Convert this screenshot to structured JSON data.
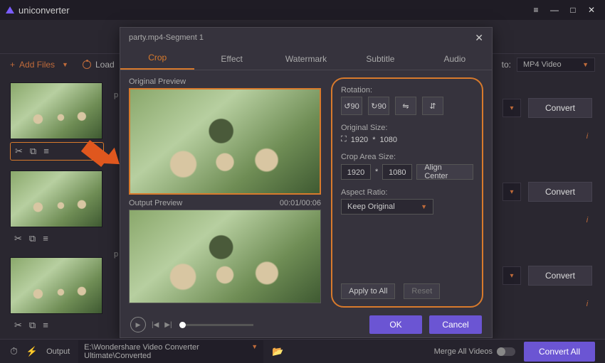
{
  "app": {
    "name": "uniconverter"
  },
  "window": {
    "menu": "≡",
    "min": "—",
    "max": "□",
    "close": "✕"
  },
  "toolbar": {
    "addfiles": "Add Files",
    "load": "Load",
    "to": "to:",
    "format": "MP4 Video"
  },
  "side": {
    "icons_cut": "✂",
    "icons_crop": "⧉",
    "icons_adjust": "≡"
  },
  "list": {
    "convert": "Convert",
    "info": "i",
    "drop": "▾",
    "p": "p"
  },
  "footer": {
    "output": "Output",
    "path": "E:\\Wondershare Video Converter Ultimate\\Converted",
    "merge": "Merge All Videos",
    "convertall": "Convert All"
  },
  "modal": {
    "title": "party.mp4-Segment 1",
    "tabs": {
      "crop": "Crop",
      "effect": "Effect",
      "watermark": "Watermark",
      "subtitle": "Subtitle",
      "audio": "Audio"
    },
    "origprev": "Original Preview",
    "outprev": "Output Preview",
    "time": "00:01/00:06",
    "rot": {
      "label": "Rotation:",
      "r1": "↺90",
      "r2": "↻90",
      "r3": "⇋",
      "r4": "⇵"
    },
    "origsize": {
      "label": "Original Size:",
      "icon": "⛶",
      "w": "1920",
      "sep": "*",
      "h": "1080"
    },
    "crop": {
      "label": "Crop Area Size:",
      "w": "1920",
      "sep": "*",
      "h": "1080",
      "align": "Align Center"
    },
    "aspect": {
      "label": "Aspect Ratio:",
      "value": "Keep Original"
    },
    "apply": "Apply to All",
    "reset": "Reset",
    "ok": "OK",
    "cancel": "Cancel",
    "play": "▶",
    "prev": "|◀",
    "next": "▶|"
  }
}
